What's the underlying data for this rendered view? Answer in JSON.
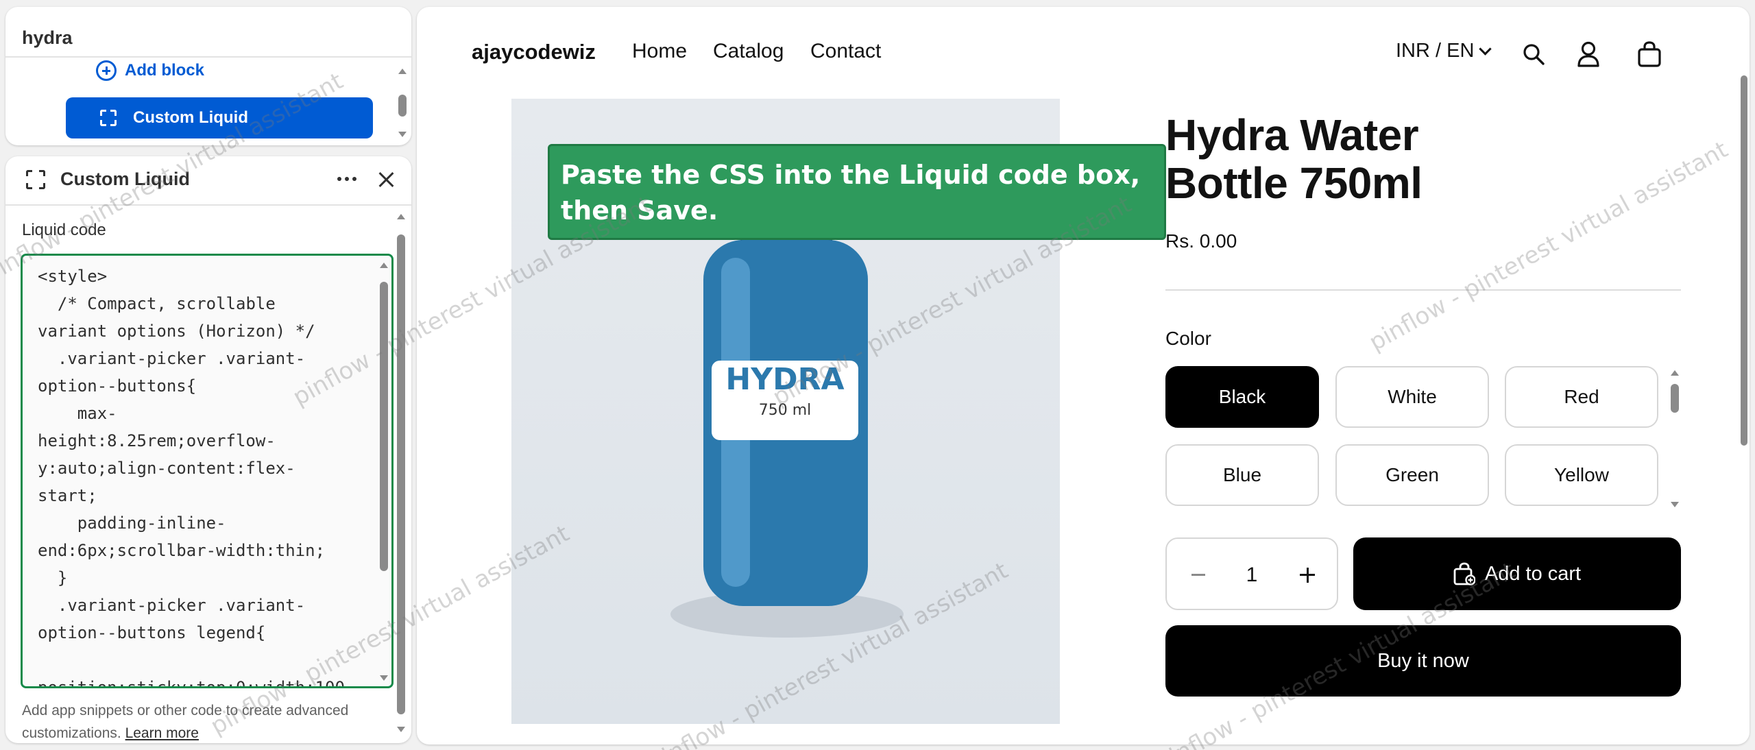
{
  "editor": {
    "store_name": "hydra",
    "add_block_label": "Add block",
    "selected_block_label": "Custom Liquid",
    "panel": {
      "title": "Custom Liquid",
      "code_label": "Liquid code",
      "code_value": "<style>\n  /* Compact, scrollable variant options (Horizon) */\n  .variant-picker .variant-option--buttons{\n    max-height:8.25rem;overflow-y:auto;align-content:flex-start;\n    padding-inline-end:6px;scrollbar-width:thin;\n  }\n  .variant-picker .variant-option--buttons legend{\n    position:sticky;top:0;width:100",
      "help_text": "Add app snippets or other code to create advanced customizations.",
      "learn_more": "Learn more"
    }
  },
  "storefront": {
    "brand": "ajaycodewiz",
    "nav": [
      "Home",
      "Catalog",
      "Contact"
    ],
    "locale": "INR / EN",
    "product": {
      "title_line1": "Hydra Water",
      "title_line2": "Bottle 750ml",
      "price": "Rs. 0.00",
      "option_label": "Color",
      "colors": [
        "Black",
        "White",
        "Red",
        "Blue",
        "Green",
        "Yellow"
      ],
      "selected_color": "Black",
      "quantity": "1",
      "add_to_cart": "Add to cart",
      "buy_now": "Buy it now",
      "image_label_brand": "HYDRA",
      "image_label_volume": "750 ml"
    }
  },
  "overlay": {
    "instruction": "Paste the CSS into the Liquid code box, then Save.",
    "watermark": "pinflow - pinterest virtual assistant"
  },
  "colors": {
    "accent_blue": "#005bd3",
    "focus_green": "#148a4a",
    "instruction_bg": "#2e9a5c",
    "bottle_blue": "#2b79ad"
  }
}
